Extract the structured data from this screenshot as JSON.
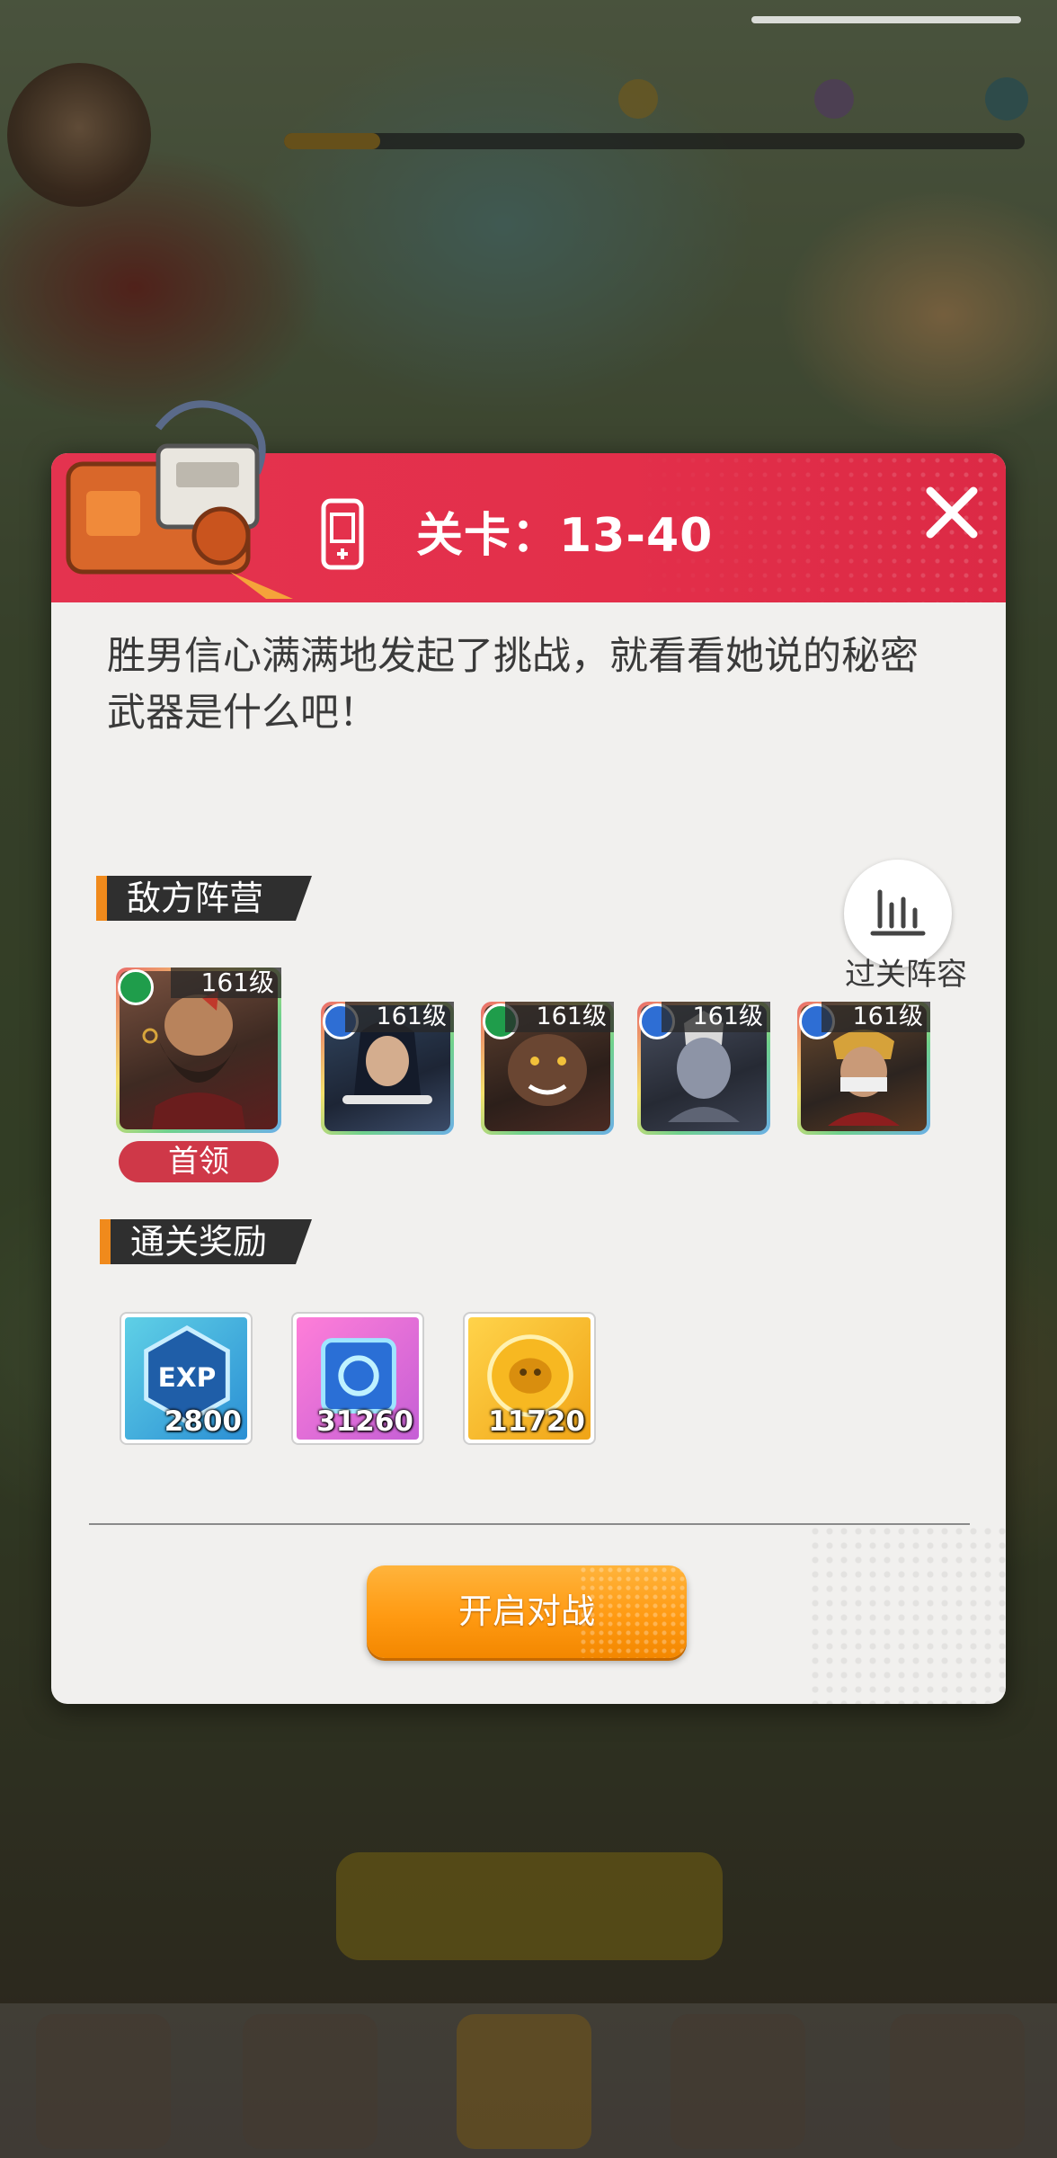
{
  "background": {
    "profile": {
      "name": "",
      "subtitle": ""
    },
    "xp_progress": 0.13,
    "resources": []
  },
  "dialog": {
    "title": "关卡：13-40",
    "close_icon": "close-icon",
    "description": "胜男信心满满地发起了挑战，就看看她说的秘密武器是什么吧！",
    "enemy_section_label": "敌方阵营",
    "formation_button_label": "过关阵容",
    "formation_icon": "bar-chart-icon",
    "boss_badge": "首领",
    "enemies": [
      {
        "level": "161级",
        "faction": "green",
        "boss": true
      },
      {
        "level": "161级",
        "faction": "blue",
        "boss": false
      },
      {
        "level": "161级",
        "faction": "green",
        "boss": false
      },
      {
        "level": "161级",
        "faction": "blue",
        "boss": false
      },
      {
        "level": "161级",
        "faction": "blue",
        "boss": false
      }
    ],
    "reward_section_label": "通关奖励",
    "rewards": [
      {
        "icon": "exp-icon",
        "label": "EXP",
        "amount": "2800"
      },
      {
        "icon": "energy-chip-icon",
        "amount": "31260"
      },
      {
        "icon": "gold-coin-icon",
        "amount": "11720"
      }
    ],
    "fight_button_label": "开启对战",
    "colors": {
      "header": "#e4334f",
      "accent_orange": "#f08a1c",
      "button": "#ff9a12",
      "boss_badge": "#cf3848",
      "faction_green": "#1f9d4b",
      "faction_blue": "#2e6ed4"
    }
  }
}
